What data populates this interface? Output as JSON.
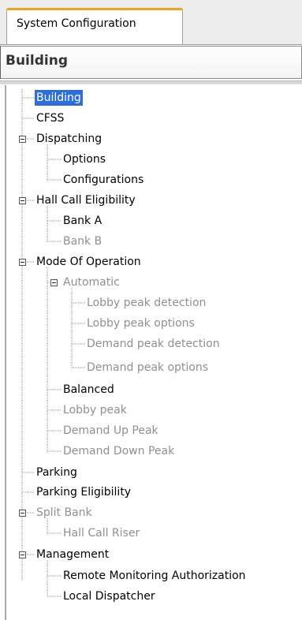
{
  "tab": {
    "label": "System Configuration"
  },
  "header": {
    "title": "Building"
  },
  "tree": {
    "building": "Building",
    "cfss": "CFSS",
    "dispatching": "Dispatching",
    "options": "Options",
    "configurations": "Configurations",
    "hall_call_eligibility": "Hall Call Eligibility",
    "bank_a": "Bank A",
    "bank_b": "Bank B",
    "mode_of_operation": "Mode Of Operation",
    "automatic": "Automatic",
    "lobby_peak_detection": "Lobby peak detection",
    "lobby_peak_options": "Lobby peak options",
    "demand_peak_detection": "Demand peak detection",
    "demand_peak_options": "Demand peak options",
    "balanced": "Balanced",
    "lobby_peak": "Lobby peak",
    "demand_up_peak": "Demand Up Peak",
    "demand_down_peak": "Demand Down Peak",
    "parking": "Parking",
    "parking_eligibility": "Parking Eligibility",
    "split_bank": "Split Bank",
    "hall_call_riser": "Hall Call Riser",
    "management": "Management",
    "remote_monitoring_authorization": "Remote Monitoring Authorization",
    "local_dispatcher": "Local Dispatcher"
  }
}
